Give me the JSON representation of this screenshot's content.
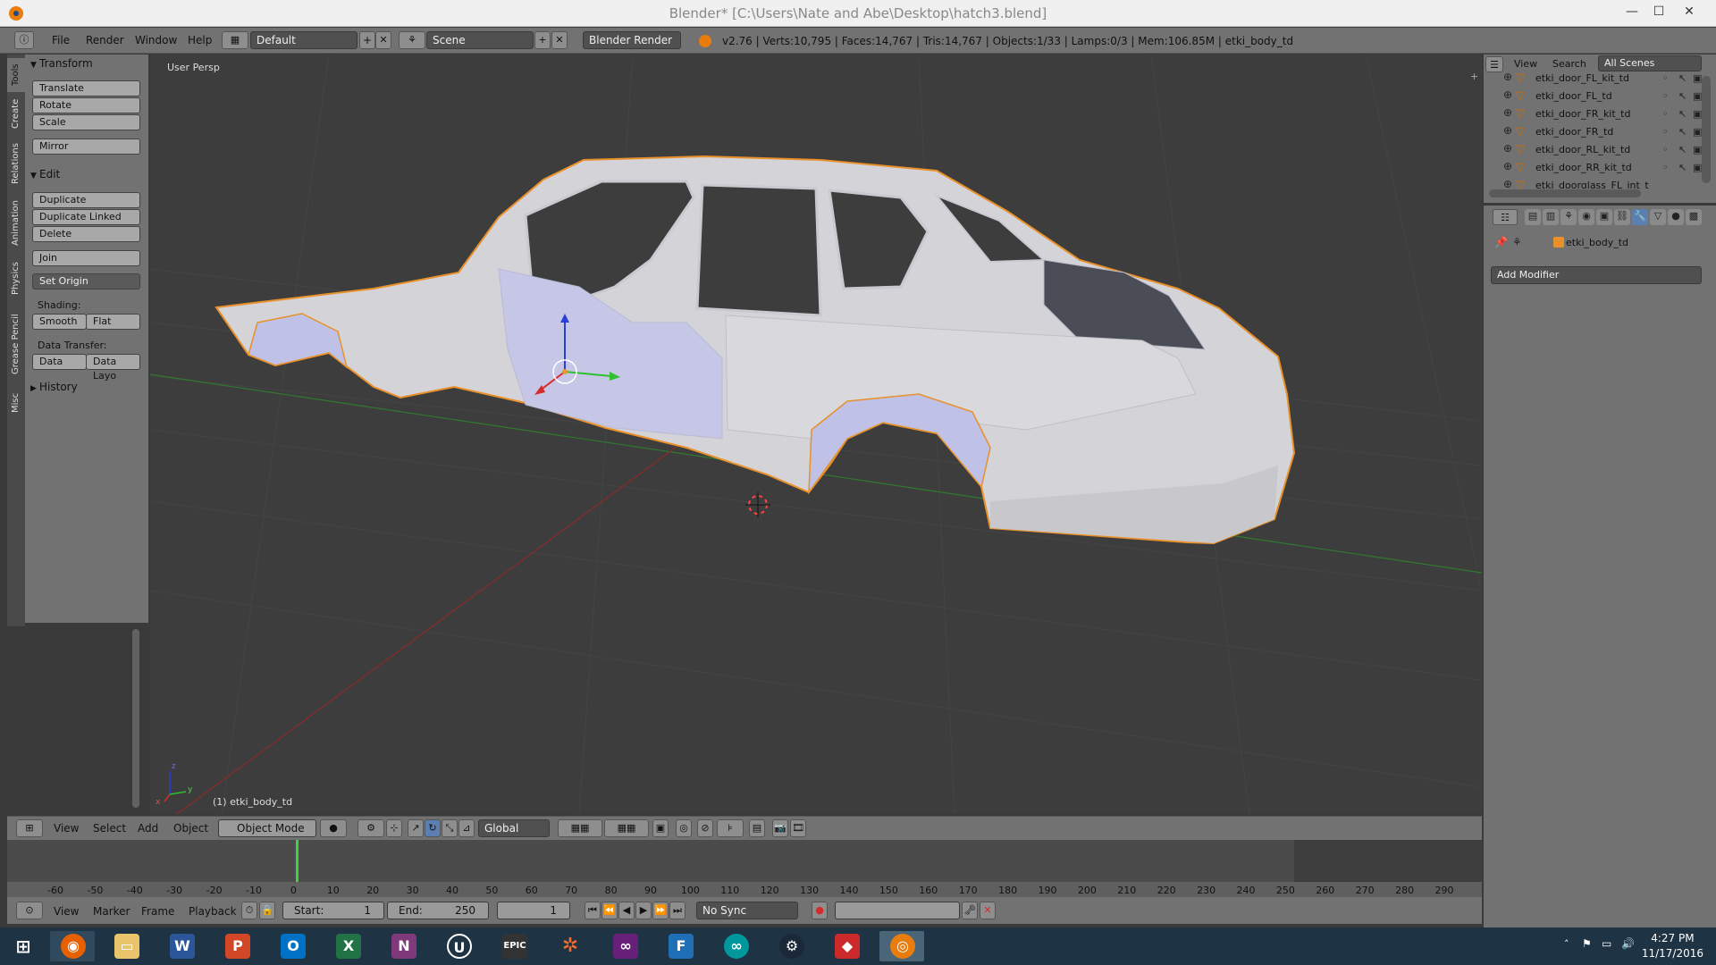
{
  "window": {
    "title": "Blender* [C:\\Users\\Nate and Abe\\Desktop\\hatch3.blend]",
    "controls": [
      "—",
      "☐",
      "✕"
    ]
  },
  "infobar": {
    "menu": [
      "File",
      "Render",
      "Window",
      "Help"
    ],
    "layout": "Default",
    "scene": "Scene",
    "engine": "Blender Render",
    "stats": "v2.76 | Verts:10,795 | Faces:14,767 | Tris:14,767 | Objects:1/33 | Lamps:0/3 | Mem:106.85M | etki_body_td"
  },
  "lefttabs": [
    "Tools",
    "Create",
    "Relations",
    "Animation",
    "Physics",
    "Grease Pencil",
    "Misc"
  ],
  "toolshelf": {
    "transform_header": "Transform",
    "translate": "Translate",
    "rotate": "Rotate",
    "scale": "Scale",
    "mirror": "Mirror",
    "edit_header": "Edit",
    "duplicate": "Duplicate",
    "duplicate_linked": "Duplicate Linked",
    "delete": "Delete",
    "join": "Join",
    "set_origin": "Set Origin",
    "shading_label": "Shading:",
    "smooth": "Smooth",
    "flat": "Flat",
    "data_transfer_label": "Data Transfer:",
    "data": "Data",
    "data_layout": "Data Layo",
    "history_header": "History"
  },
  "viewport": {
    "view_label": "User Persp",
    "object_label": "(1) etki_body_td",
    "axis_x": "x",
    "axis_y": "y",
    "axis_z": "z"
  },
  "outliner": {
    "menu": [
      "View",
      "Search"
    ],
    "filter": "All Scenes",
    "items": [
      "etki_door_FL_kit_td",
      "etki_door_FL_td",
      "etki_door_FR_kit_td",
      "etki_door_FR_td",
      "etki_door_RL_kit_td",
      "etki_door_RR_kit_td",
      "etki_doorglass_FL_int_t"
    ]
  },
  "properties": {
    "object_name": "etki_body_td",
    "add_modifier": "Add Modifier"
  },
  "view3d_header": {
    "menu": [
      "View",
      "Select",
      "Add",
      "Object"
    ],
    "mode": "Object Mode",
    "orientation": "Global"
  },
  "timeline": {
    "ticks": [
      "-60",
      "-50",
      "-40",
      "-30",
      "-20",
      "-10",
      "0",
      "10",
      "20",
      "30",
      "40",
      "50",
      "60",
      "70",
      "80",
      "90",
      "100",
      "110",
      "120",
      "130",
      "140",
      "150",
      "160",
      "170",
      "180",
      "190",
      "200",
      "210",
      "220",
      "230",
      "240",
      "250",
      "260",
      "270",
      "280",
      "290"
    ],
    "menu": [
      "View",
      "Marker",
      "Frame",
      "Playback"
    ],
    "start_label": "Start:",
    "start_value": "1",
    "end_label": "End:",
    "end_value": "250",
    "current_frame": "1",
    "sync": "No Sync"
  },
  "taskbar": {
    "apps": [
      "windows-start",
      "firefox",
      "file-explorer",
      "word",
      "powerpoint",
      "outlook",
      "excel",
      "onenote",
      "unreal-engine",
      "epic-games",
      "origin",
      "visual-studio",
      "fusion",
      "arduino",
      "steam",
      "adobe",
      "blender"
    ],
    "time": "4:27 PM",
    "date": "11/17/2016"
  },
  "colors": {
    "accent": "#e87d0d",
    "panel": "#727272",
    "viewport": "#3d3d3d"
  }
}
